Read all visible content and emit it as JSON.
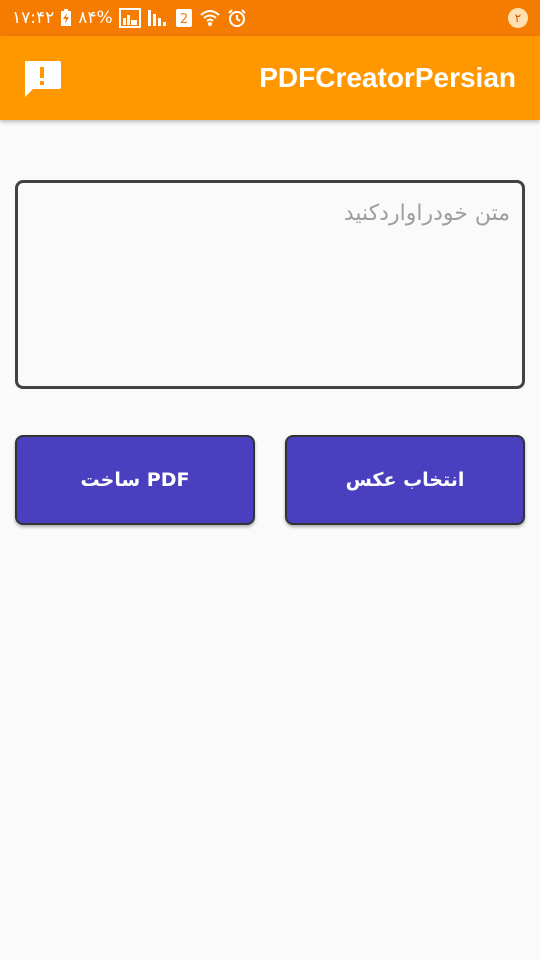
{
  "status_bar": {
    "time": "۱۷:۴۲",
    "battery": "۸۴%",
    "notification_count": "۲",
    "sim_label": "2"
  },
  "app_bar": {
    "title": "PDFCreatorPersian",
    "feedback_icon": "feedback-icon"
  },
  "editor": {
    "placeholder": "متن خودراواردکنید",
    "value": ""
  },
  "buttons": {
    "create_pdf_label": "ساخت PDF",
    "pick_image_label": "انتخاب عکس"
  },
  "colors": {
    "status_bar": "#f57c00",
    "app_bar": "#ff9800",
    "button": "#4a3fbf",
    "background": "#fafafa"
  }
}
